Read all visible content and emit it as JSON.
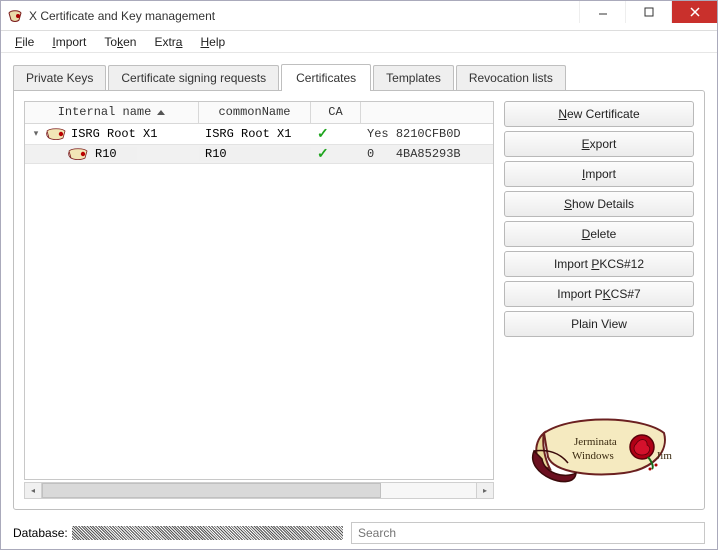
{
  "window": {
    "title": "X Certificate and Key management"
  },
  "menu": {
    "file": "File",
    "import": "Import",
    "token": "Token",
    "extra": "Extra",
    "help": "Help"
  },
  "tabs": {
    "private_keys": "Private Keys",
    "csr": "Certificate signing requests",
    "certificates": "Certificates",
    "templates": "Templates",
    "revocation": "Revocation lists",
    "active": "certificates"
  },
  "columns": {
    "internal_name": "Internal name",
    "common_name": "commonName",
    "ca": "CA"
  },
  "rows": [
    {
      "name": "ISRG Root X1",
      "cn": "ISRG Root X1",
      "ca_flag": "Yes",
      "extra": "8210CFB0D",
      "expanded": true,
      "level": 0,
      "selected": false
    },
    {
      "name": "R10",
      "cn": "R10",
      "ca_flag": "0",
      "extra": "4BA85293B",
      "level": 1,
      "selected": true
    }
  ],
  "buttons": {
    "new_cert": "ew Certificate",
    "new_cert_mn": "N",
    "export": "xport",
    "export_mn": "E",
    "import": "mport",
    "import_mn": "I",
    "show_details": "how Details",
    "show_details_mn": "S",
    "delete": "elete",
    "delete_mn": "D",
    "import_p12_pre": "Import ",
    "import_p12_mn": "P",
    "import_p12_post": "KCS#12",
    "import_p7_pre": "Import P",
    "import_p7_mn": "K",
    "import_p7_post": "CS#7",
    "plain_view": "Plain View"
  },
  "status": {
    "db_label": "Database:",
    "search_placeholder": "Search"
  }
}
